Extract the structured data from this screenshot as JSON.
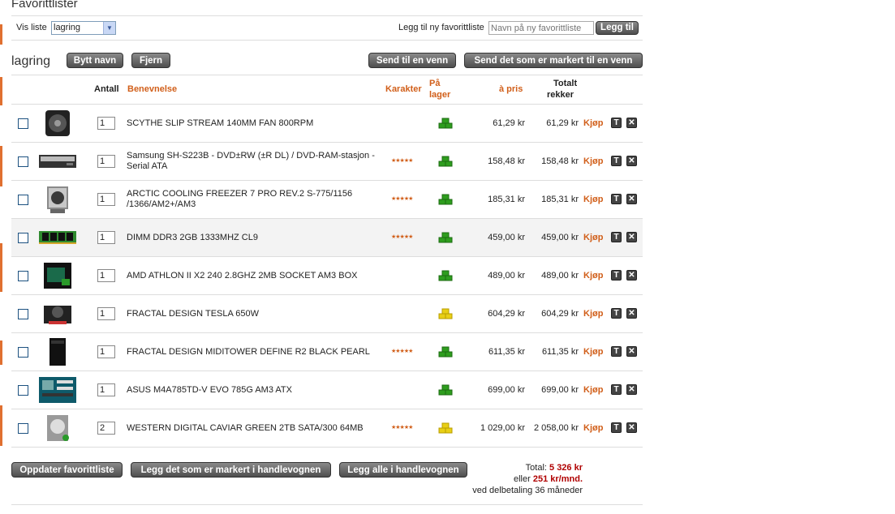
{
  "page_title": "Favorittlister",
  "view_list": {
    "label": "Vis liste",
    "selected": "lagring"
  },
  "new_list": {
    "label": "Legg til ny favorittliste",
    "placeholder": "Navn på ny favorittliste",
    "add_button": "Legg til"
  },
  "list": {
    "name": "lagring",
    "rename_button": "Bytt navn",
    "remove_button": "Fjern",
    "send_button": "Send til en venn",
    "send_selected_button": "Send det som er markert til en venn"
  },
  "columns": {
    "quantity": "Antall",
    "description": "Benevnelse",
    "rating": "Karakter",
    "stock_line1": "På",
    "stock_line2": "lager",
    "price": "à pris",
    "total_line1": "Totalt",
    "total_line2": "rekker"
  },
  "buy_label": "Kjøp",
  "rows": [
    {
      "name": "SCYTHE SLIP STREAM 140MM FAN 800RPM",
      "qty": "1",
      "rating": "",
      "stock": "green",
      "price": "61,29 kr",
      "total": "61,29 kr",
      "thumb": "fan-cooler-image"
    },
    {
      "name": "Samsung SH-S223B - DVD±RW (±R DL) / DVD-RAM-stasjon - Serial ATA",
      "qty": "1",
      "rating": "★★★★★",
      "stock": "green",
      "price": "158,48 kr",
      "total": "158,48 kr",
      "thumb": "dvd-drive-image"
    },
    {
      "name": "ARCTIC COOLING FREEZER 7 PRO REV.2 S-775/1156 /1366/AM2+/AM3",
      "qty": "1",
      "rating": "★★★★★",
      "stock": "green",
      "price": "185,31 kr",
      "total": "185,31 kr",
      "thumb": "cpu-cooler-image"
    },
    {
      "name": "DIMM DDR3 2GB 1333MHZ CL9",
      "qty": "1",
      "rating": "★★★★★",
      "stock": "green",
      "price": "459,00 kr",
      "total": "459,00 kr",
      "thumb": "ram-module-image"
    },
    {
      "name": "AMD ATHLON II X2 240 2.8GHZ 2MB SOCKET AM3 BOX",
      "qty": "1",
      "rating": "",
      "stock": "green",
      "price": "489,00 kr",
      "total": "489,00 kr",
      "thumb": "cpu-box-image"
    },
    {
      "name": "FRACTAL DESIGN TESLA 650W",
      "qty": "1",
      "rating": "",
      "stock": "yellow",
      "price": "604,29 kr",
      "total": "604,29 kr",
      "thumb": "power-supply-image"
    },
    {
      "name": "FRACTAL DESIGN MIDITOWER DEFINE R2 BLACK PEARL",
      "qty": "1",
      "rating": "★★★★★",
      "stock": "green",
      "price": "611,35 kr",
      "total": "611,35 kr",
      "thumb": "pc-case-image"
    },
    {
      "name": "ASUS M4A785TD-V EVO 785G AM3 ATX",
      "qty": "1",
      "rating": "",
      "stock": "green",
      "price": "699,00 kr",
      "total": "699,00 kr",
      "thumb": "motherboard-image"
    },
    {
      "name": "WESTERN DIGITAL CAVIAR GREEN 2TB SATA/300 64MB",
      "qty": "2",
      "rating": "★★★★★",
      "stock": "yellow",
      "price": "1 029,00 kr",
      "total": "2 058,00 kr",
      "thumb": "hard-drive-image"
    }
  ],
  "bottom": {
    "update_button": "Oppdater favorittliste",
    "add_selected_button": "Legg det som er markert i handlevognen",
    "add_all_button": "Legg alle i handlevognen",
    "total_label": "Total:",
    "total_value": "5 326 kr",
    "monthly_prefix": "eller",
    "monthly_value": "251 kr/mnd.",
    "installment_note": "ved delbetaling 36 måneder"
  },
  "colors": {
    "accent": "#d15f1a",
    "price_red": "#b00000",
    "stock_green": "#2e9d1e",
    "stock_yellow": "#e8cf16"
  }
}
